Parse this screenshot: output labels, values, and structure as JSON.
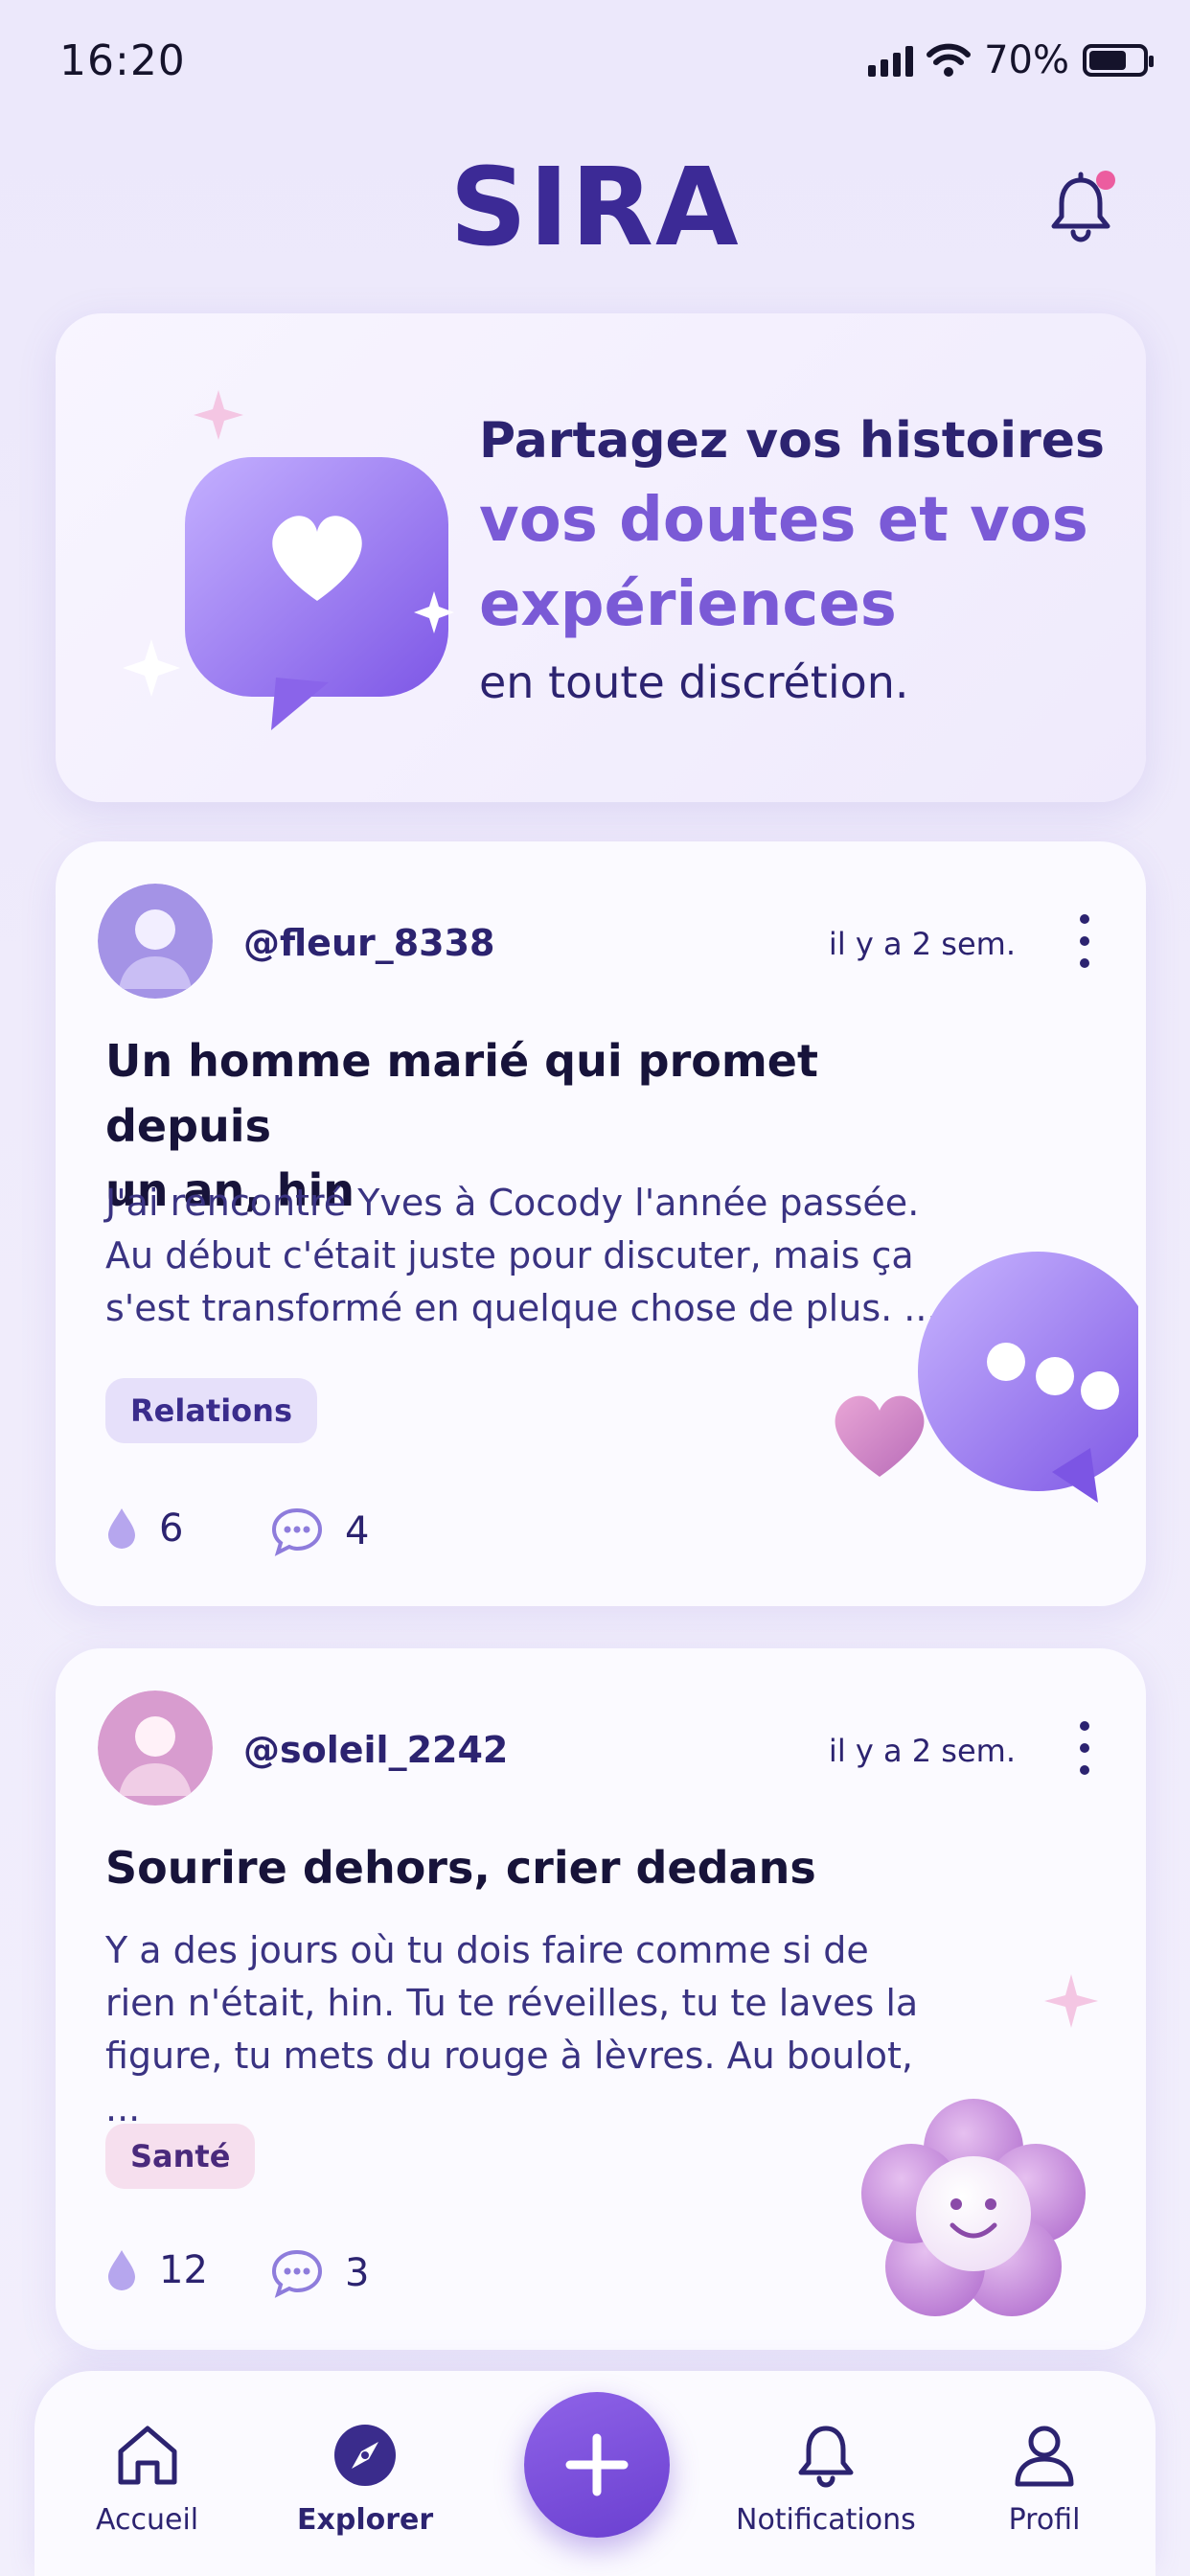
{
  "status_bar": {
    "time": "16:20",
    "battery": "70%",
    "battery_level": 0.7
  },
  "header": {
    "title": "SIRA",
    "has_notification_dot": true
  },
  "hero": {
    "line1": "Partagez vos histoires",
    "line2a": "vos doutes et vos",
    "line2b": "expériences",
    "line3": "en toute discrétion."
  },
  "posts": [
    {
      "username": "@fleur_8338",
      "time": "il y a 2 sem.",
      "title_a": "Un homme marié qui promet depuis",
      "title_b": "un an, hin",
      "body_a": "J'ai rencontré Yves à Cocody l'année passée.",
      "body_b": "Au début c'était juste pour discuter, mais ça",
      "body_c": "s'est transformé en quelque chose de plus. ...",
      "tag": "Relations",
      "likes": "6",
      "comments": "4",
      "avatar_color": "#a493e6",
      "icon": "chat-bubble-heart-icon"
    },
    {
      "username": "@soleil_2242",
      "time": "il y a 2 sem.",
      "title_a": "Sourire dehors, crier dedans",
      "body_a": "Y a des jours où tu dois faire comme si de",
      "body_b": "rien n'était, hin. Tu te réveilles, tu te laves la",
      "body_c": "figure, tu mets du rouge à lèvres. Au boulot, ...",
      "tag": "Santé",
      "likes": "12",
      "comments": "3",
      "avatar_color": "#d89ccf",
      "icon": "smiling-flower-icon"
    }
  ],
  "nav": {
    "home": "Accueil",
    "explore": "Explorer",
    "notifications": "Notifications",
    "profile": "Profil",
    "active": "Explorer"
  },
  "colors": {
    "accent": "#6a3fd0",
    "brand": "#3c2a96",
    "highlight": "#7a5ad6",
    "dot": "#ec5d9f"
  }
}
